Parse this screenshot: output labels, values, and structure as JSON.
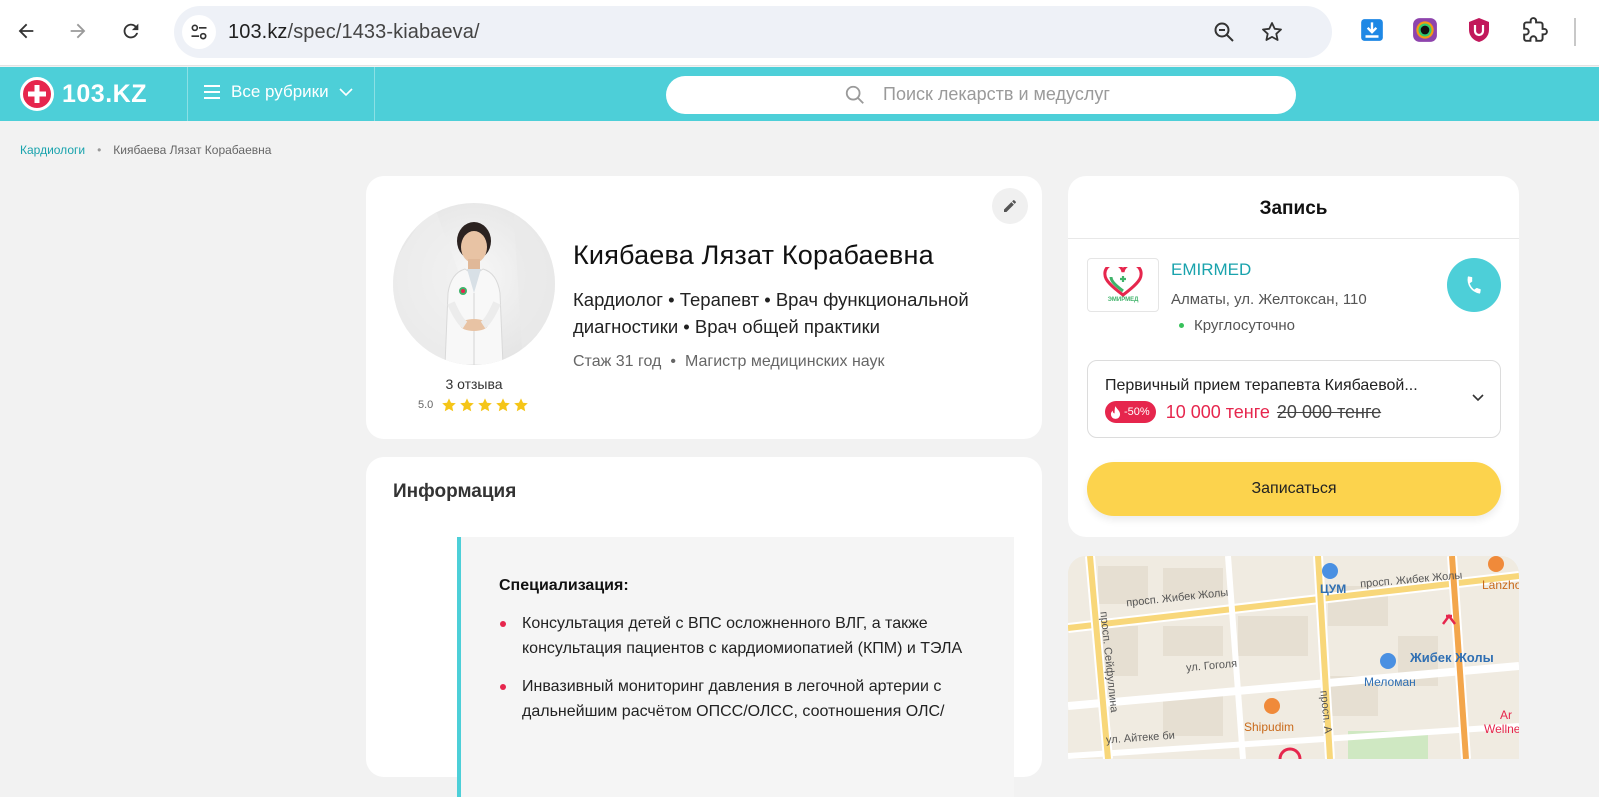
{
  "browser": {
    "url_host": "103.kz",
    "url_path": "/spec/1433-kiabaeva/"
  },
  "header": {
    "logo_text": "103.KZ",
    "rubrics_label": "Все рубрики",
    "search_placeholder": "Поиск лекарств и медуслуг"
  },
  "breadcrumb": {
    "parent": "Кардиологи",
    "current": "Киябаева Лязат Корабаевна"
  },
  "profile": {
    "name": "Киябаева Лязат Корабаевна",
    "specialties": "Кардиолог • Терапевт • Врач функциональной диагностики • Врач общей практики",
    "experience": "Стаж 31 год",
    "degree": "Магистр медицинских наук",
    "reviews": "3 отзыва",
    "rating": "5.0",
    "stars": 5
  },
  "info": {
    "title": "Информация",
    "subtitle": "Специализация:",
    "items": [
      "Консультация детей с ВПС осложненного ВЛГ, а также консультация пациентов с кардиомиопатией (КПМ) и ТЭЛА",
      "Инвазивный мониторинг давления в легочной артерии с дальнейшим расчётом ОПСС/ОЛСС, соотношения ОЛС/"
    ]
  },
  "booking": {
    "title": "Запись",
    "clinic_name": "EMIRMED",
    "clinic_logo_text": "ЭМИРМЕД",
    "clinic_address": "Алматы, ул. Желтоксан, 110",
    "clinic_hours": "Круглосуточно",
    "service_name": "Первичный прием терапевта Киябаевой...",
    "discount": "-50%",
    "price_new": "10 000 тенге",
    "price_old": "20 000 тенге",
    "book_button": "Записаться"
  },
  "map": {
    "labels": {
      "street1": "просп. Жибек Жолы",
      "street2": "просп. Жибек Жолы",
      "street3": "просп. Сейфуллина",
      "street4": "ул. Гоголя",
      "street5": "ул. Айтеке би",
      "street6": "просп. А",
      "poi_tsum": "ЦУМ",
      "poi_metro": "Жибек Жолы",
      "poi_meloman": "Меломан",
      "poi_shipudim": "Shipudim",
      "poi_lanzhou": "Lanzho",
      "poi_wellness": "Wellne",
      "poi_ar": "Ar"
    }
  },
  "colors": {
    "brand_teal": "#4dcfd8",
    "brand_red": "#e6264d",
    "button_yellow": "#fcd34d",
    "link_teal": "#19a3ad"
  }
}
